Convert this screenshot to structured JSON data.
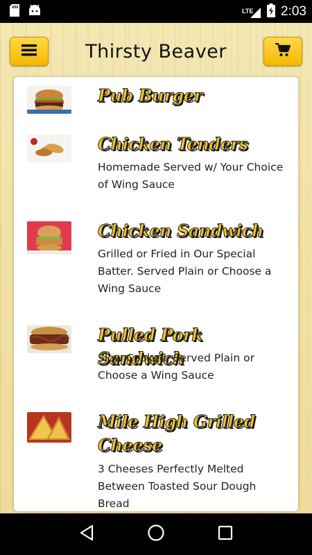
{
  "status_bar": {
    "network": "LTE",
    "time": "2:03",
    "icons": [
      "sd-card-icon",
      "android-icon",
      "signal-icon",
      "battery-charging-icon"
    ]
  },
  "toolbar": {
    "title": "Thirsty Beaver",
    "menu_icon": "hamburger-icon",
    "cart_icon": "cart-icon"
  },
  "colors": {
    "button_yellow": "#f5b800",
    "item_name": "#f9c629",
    "item_name_outline": "#1a1a1a",
    "background_wood": "#f1e2a6"
  },
  "menu": {
    "items": [
      {
        "name": "Pub Burger",
        "description": "",
        "thumb_icon": "burger-photo"
      },
      {
        "name": "Chicken Tenders",
        "description": "Homemade Served w/ Your Choice of Wing Sauce",
        "thumb_icon": "chicken-tenders-photo"
      },
      {
        "name": "Chicken Sandwich",
        "description": "Grilled or Fried in Our Special Batter. Served Plain or Choose a Wing Sauce",
        "thumb_icon": "chicken-sandwich-photo"
      },
      {
        "name": "Pulled Pork Sandwich",
        "description": "Slow Cooked, Served Plain or Choose a Wing Sauce",
        "thumb_icon": "pulled-pork-photo"
      },
      {
        "name": "Mile High Grilled Cheese",
        "description": "3 Cheeses Perfectly Melted Between Toasted Sour Dough Bread",
        "thumb_icon": "grilled-cheese-photo"
      }
    ]
  },
  "nav_bar": {
    "buttons": [
      "back-icon",
      "home-icon",
      "recents-icon"
    ]
  }
}
